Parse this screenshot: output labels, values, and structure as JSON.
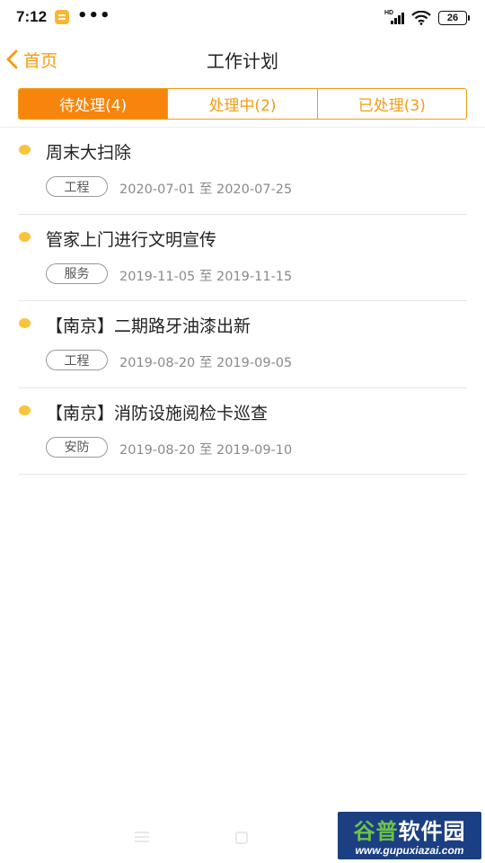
{
  "status_bar": {
    "time": "7:12",
    "more": "•••",
    "network_badge": "HD",
    "battery": "26"
  },
  "nav": {
    "back_label": "首页",
    "title": "工作计划"
  },
  "tabs": [
    {
      "label": "待处理(4)",
      "active": true
    },
    {
      "label": "处理中(2)",
      "active": false
    },
    {
      "label": "已处理(3)",
      "active": false
    }
  ],
  "tasks": [
    {
      "title": "周末大扫除",
      "tag": "工程",
      "dates": "2020-07-01 至 2020-07-25"
    },
    {
      "title": "管家上门进行文明宣传",
      "tag": "服务",
      "dates": "2019-11-05 至 2019-11-15"
    },
    {
      "title": "【南京】二期路牙油漆出新",
      "tag": "工程",
      "dates": "2019-08-20 至 2019-09-05"
    },
    {
      "title": "【南京】消防设施阅检卡巡查",
      "tag": "安防",
      "dates": "2019-08-20 至 2019-09-10"
    }
  ],
  "watermark": {
    "brand_part1": "谷普",
    "brand_part2": "软件园",
    "url": "www.gupuxiazai.com"
  },
  "colors": {
    "accent": "#f39c12",
    "active_tab": "#f7850d",
    "dot": "#f8c43a",
    "watermark_bg": "#1b3f82"
  }
}
